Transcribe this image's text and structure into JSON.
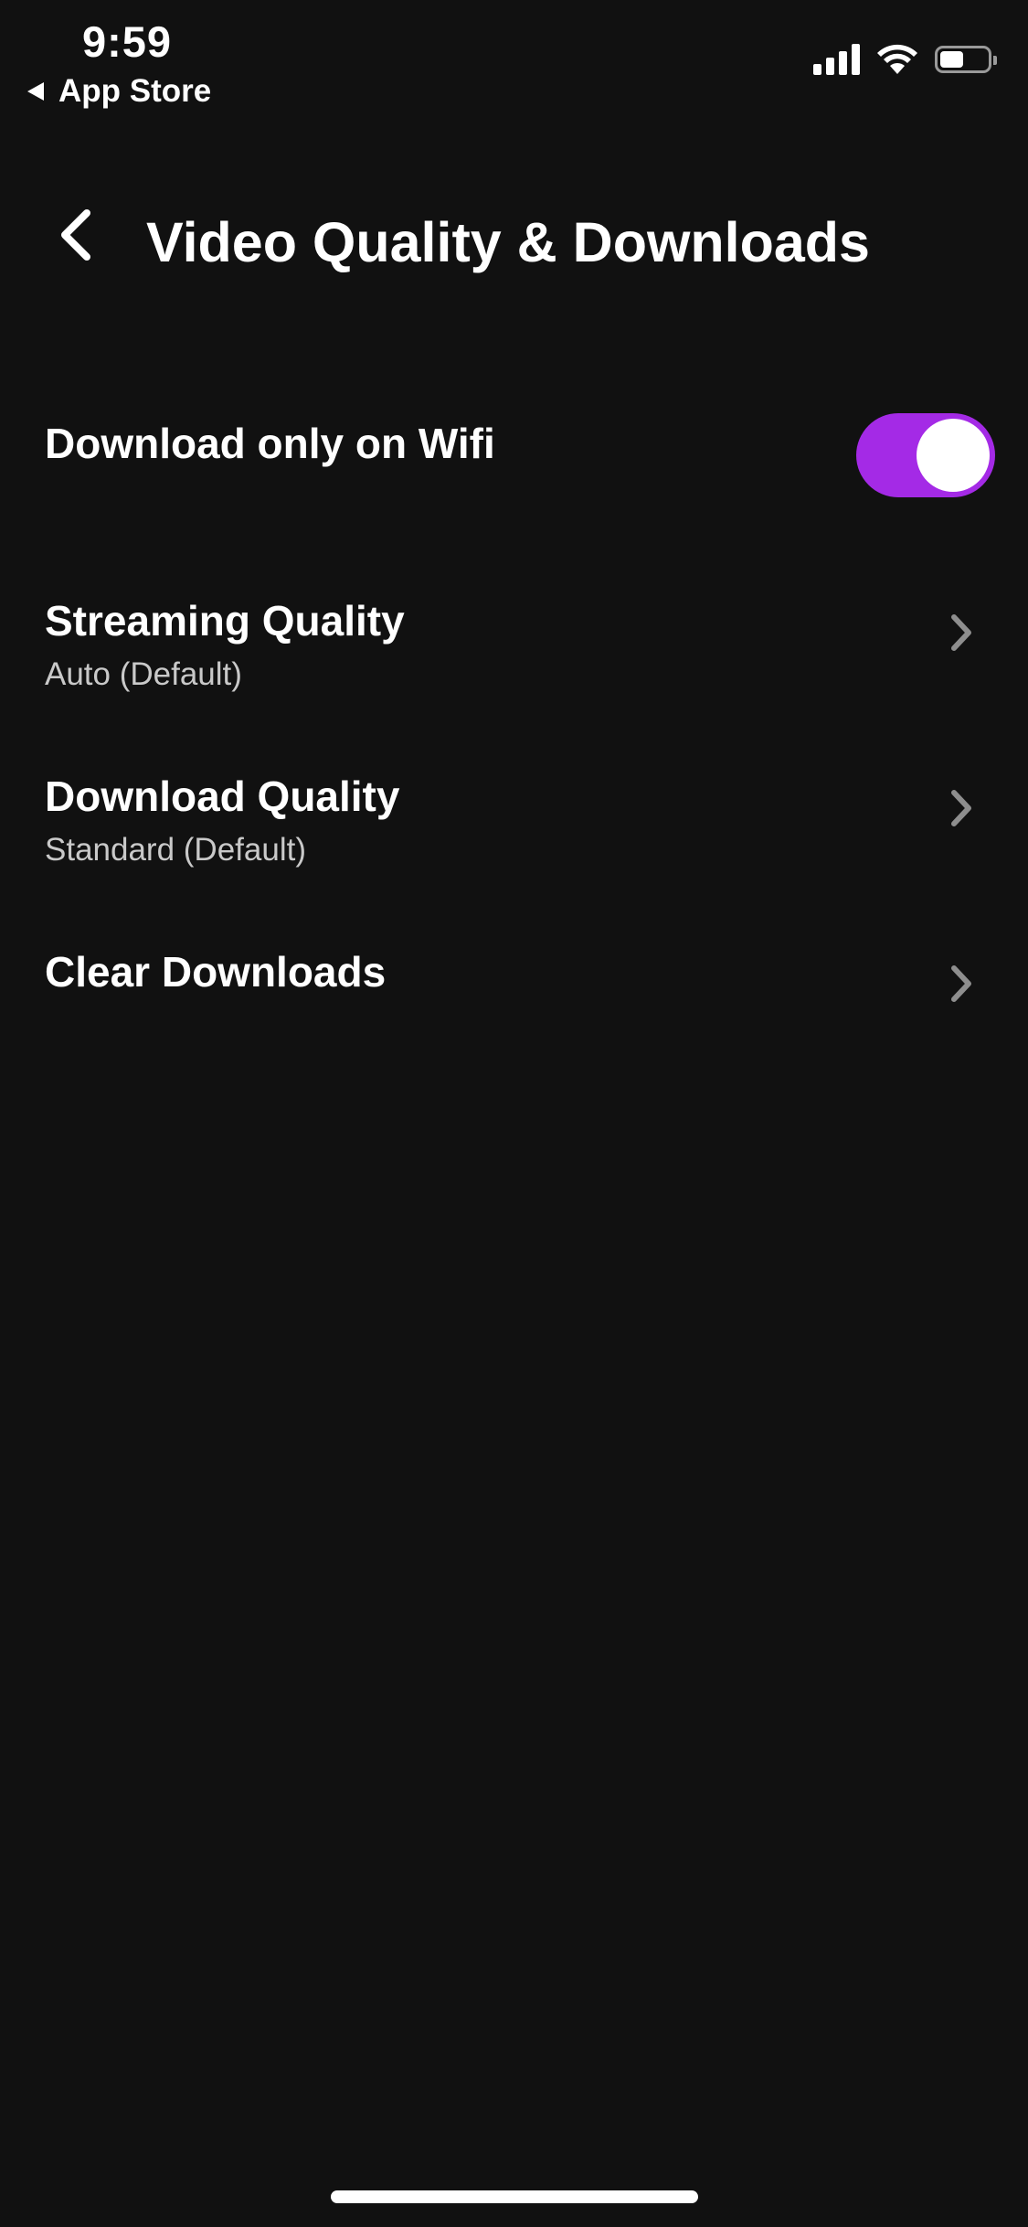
{
  "status_bar": {
    "time": "9:59",
    "back_app_label": "App Store",
    "battery_level": 0.5,
    "icons": [
      "signal-icon",
      "wifi-icon",
      "battery-icon"
    ]
  },
  "header": {
    "back_icon": "chevron-left-icon",
    "title": "Video Quality & Downloads"
  },
  "settings": {
    "wifi_only": {
      "label": "Download only on Wifi",
      "enabled": true
    },
    "items": [
      {
        "title": "Streaming Quality",
        "value": "Auto (Default)",
        "icon": "chevron-right-icon"
      },
      {
        "title": "Download Quality",
        "value": "Standard (Default)",
        "icon": "chevron-right-icon"
      },
      {
        "title": "Clear Downloads",
        "icon": "chevron-right-icon"
      }
    ]
  },
  "colors": {
    "background": "#111111",
    "accent": "#a42ae6",
    "text_primary": "#ffffff",
    "text_secondary": "#c9c9c9",
    "chevron": "#8e8e8e"
  }
}
